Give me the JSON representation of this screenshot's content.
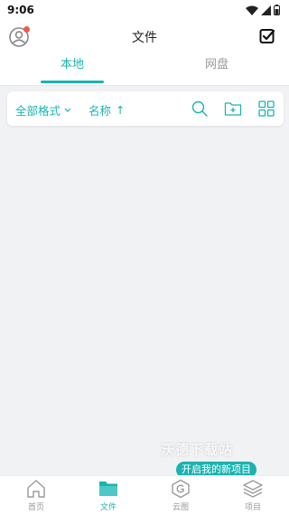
{
  "status_bar": {
    "time": "9:06"
  },
  "header": {
    "title": "文件"
  },
  "tabs": [
    {
      "label": "本地",
      "active": true
    },
    {
      "label": "网盘",
      "active": false
    }
  ],
  "filter_bar": {
    "format_label": "全部格式",
    "sort_label": "名称",
    "sort_arrow": "↑"
  },
  "watermark": "沃德下载站",
  "project_bubble": "开启我的新项目",
  "bottom_nav": [
    {
      "label": "首页",
      "icon": "home-icon",
      "active": false
    },
    {
      "label": "文件",
      "icon": "folder-icon",
      "active": true
    },
    {
      "label": "云图",
      "icon": "cloud-logo-icon",
      "active": false
    },
    {
      "label": "项目",
      "icon": "layers-icon",
      "active": false
    }
  ],
  "colors": {
    "accent": "#1bb3b0",
    "badge": "#f25a4a",
    "background": "#f1f2f4"
  }
}
